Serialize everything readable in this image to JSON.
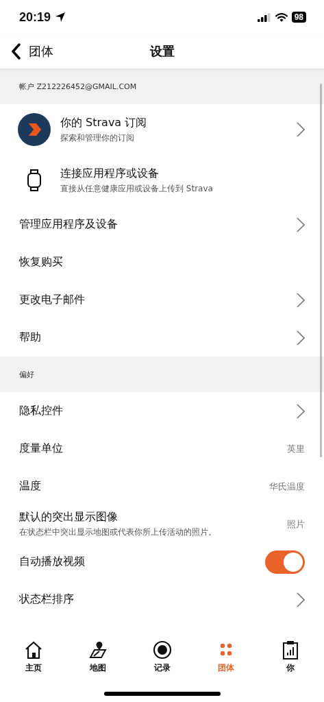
{
  "status_bar": {
    "time": "20:19",
    "battery": "98"
  },
  "nav": {
    "back_label": "团体",
    "title": "设置"
  },
  "sections": [
    {
      "header": "帐户 Z212226452@GMAIL.COM",
      "items": [
        {
          "kind": "nav",
          "title": "你的 Strava 订阅",
          "subtitle": "探索和管理你的订阅"
        },
        {
          "kind": "plain",
          "title": "连接应用程序或设备",
          "subtitle": "直接从任意健康应用或设备上传到 Strava"
        },
        {
          "kind": "nav",
          "title": "管理应用程序及设备"
        },
        {
          "kind": "plain",
          "title": "恢复购买"
        },
        {
          "kind": "nav",
          "title": "更改电子邮件"
        },
        {
          "kind": "nav",
          "title": "帮助"
        }
      ]
    },
    {
      "header": "偏好",
      "items": [
        {
          "kind": "nav",
          "title": "隐私控件"
        },
        {
          "kind": "value",
          "title": "度量单位",
          "value": "英里"
        },
        {
          "kind": "value",
          "title": "温度",
          "value": "华氏温度"
        },
        {
          "kind": "value",
          "title": "默认的突出显示图像",
          "subtitle": "在状态栏中突出显示地图或代表你所上传活动的照片。",
          "value": "照片"
        },
        {
          "kind": "toggle",
          "title": "自动播放视频",
          "on": true
        },
        {
          "kind": "nav",
          "title": "状态栏排序"
        }
      ]
    }
  ],
  "tab_bar": [
    {
      "label": "主页",
      "selected": false
    },
    {
      "label": "地图",
      "selected": false
    },
    {
      "label": "记录",
      "selected": false
    },
    {
      "label": "团体",
      "selected": true
    },
    {
      "label": "你",
      "selected": false
    }
  ]
}
